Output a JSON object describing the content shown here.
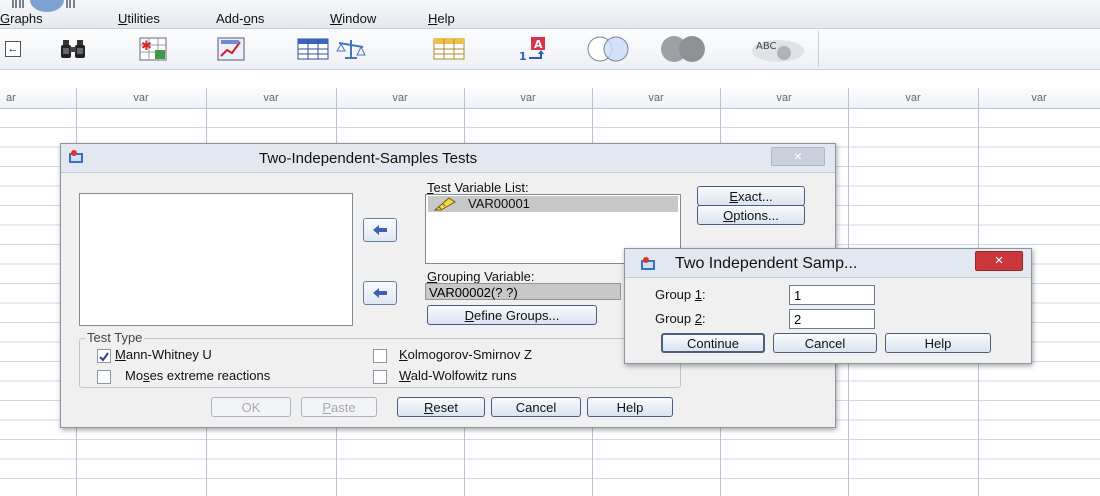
{
  "menubar": {
    "items": [
      {
        "label": "Graphs",
        "mnemonic": "G"
      },
      {
        "label": "Utilities",
        "mnemonic": "U"
      },
      {
        "label": "Add-ons",
        "mnemonic": "o"
      },
      {
        "label": "Window",
        "mnemonic": "W"
      },
      {
        "label": "Help",
        "mnemonic": "H"
      }
    ]
  },
  "toolbar": {
    "first_glyph": "←",
    "icons": [
      "binoculars-icon",
      "insert-cases-icon",
      "chart-builder-icon",
      "data-grid-icon",
      "weight-cases-icon",
      "split-file-icon",
      "value-labels-icon",
      "use-sets-icon",
      "show-all-variables-icon",
      "spell-check-icon"
    ],
    "spell_label": "ABC"
  },
  "grid": {
    "columns": [
      "ar",
      "var",
      "var",
      "var",
      "var",
      "var",
      "var",
      "var",
      "var"
    ]
  },
  "main_dialog": {
    "title": "Two-Independent-Samples Tests",
    "test_variable_list_label": "Test Variable List:",
    "test_variables": [
      "VAR00001"
    ],
    "grouping_variable_label": "Grouping Variable:",
    "grouping_variable_value": "VAR00002(? ?)",
    "define_groups_label": "Define Groups...",
    "exact_label": "Exact...",
    "options_label": "Options...",
    "test_type_label": "Test Type",
    "tests": [
      {
        "label": "Mann-Whitney U",
        "checked": true
      },
      {
        "label": "Kolmogorov-Smirnov Z",
        "checked": false
      },
      {
        "label": "Moses extreme reactions",
        "checked": false
      },
      {
        "label": "Wald-Wolfowitz runs",
        "checked": false
      }
    ],
    "buttons": {
      "ok": "OK",
      "paste": "Paste",
      "reset": "Reset",
      "cancel": "Cancel",
      "help": "Help"
    },
    "close_glyph": "×"
  },
  "sub_dialog": {
    "title": "Two Independent Samp...",
    "group1_label": "Group 1:",
    "group1_value": "1",
    "group2_label": "Group 2:",
    "group2_value": "2",
    "buttons": {
      "continue": "Continue",
      "cancel": "Cancel",
      "help": "Help"
    },
    "close_glyph": "×",
    "close_color": "#c9393b"
  }
}
